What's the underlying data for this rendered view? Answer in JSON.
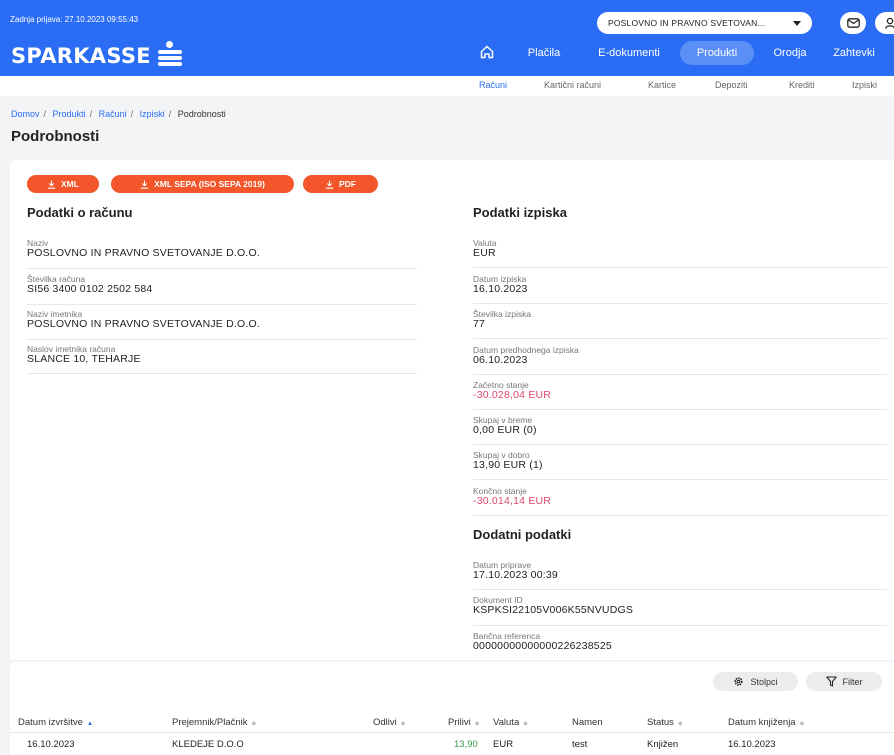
{
  "header": {
    "last_login": "Zadnja prijava: 27.10.2023 09:55:43",
    "company": "POSLOVNO IN PRAVNO SVETOVAN...",
    "brand": "SPARKASSE",
    "nav": [
      "Plačila",
      "E-dokumenti",
      "Produkti",
      "Orodja",
      "Zahtevki"
    ],
    "active_nav": "Produkti"
  },
  "subnav": {
    "items": [
      "Računi",
      "Kartični računi",
      "Kartice",
      "Depoziti",
      "Krediti",
      "Izpiski"
    ],
    "active": "Računi"
  },
  "breadcrumb": [
    "Domov",
    "Produkti",
    "Računi",
    "Izpiski",
    "Podrobnosti"
  ],
  "page_title": "Podrobnosti",
  "buttons": {
    "xml": "XML",
    "xml_sepa": "XML SEPA (ISO SEPA 2019)",
    "pdf": "PDF"
  },
  "account": {
    "title": "Podatki o računu",
    "fields": [
      {
        "label": "Naziv",
        "value": "POSLOVNO IN PRAVNO SVETOVANJE D.O.O."
      },
      {
        "label": "Številka računa",
        "value": "SI56 3400 0102 2502 584"
      },
      {
        "label": "Naziv imetnika",
        "value": "POSLOVNO IN PRAVNO SVETOVANJE D.O.O."
      },
      {
        "label": "Naslov imetnika računa",
        "value": "SLANCE 10, TEHARJE"
      }
    ]
  },
  "statement": {
    "title": "Podatki izpiska",
    "fields": [
      {
        "label": "Valuta",
        "value": "EUR"
      },
      {
        "label": "Datum izpiska",
        "value": "16.10.2023"
      },
      {
        "label": "Številka izpiska",
        "value": "77"
      },
      {
        "label": "Datum predhodnega izpiska",
        "value": "06.10.2023"
      },
      {
        "label": "Začetno stanje",
        "value": "-30.028,04 EUR"
      },
      {
        "label": "Skupaj v breme",
        "value": "0,00 EUR (0)"
      },
      {
        "label": "Skupaj v dobro",
        "value": "13,90 EUR (1)"
      },
      {
        "label": "Končno stanje",
        "value": "-30.014,14 EUR"
      }
    ]
  },
  "additional": {
    "title": "Dodatni podatki",
    "fields": [
      {
        "label": "Datum priprave",
        "value": "17.10.2023 00:39"
      },
      {
        "label": "Dokument ID",
        "value": "KSPKSI22105V006K55NVUDGS"
      },
      {
        "label": "Bančna referenca",
        "value": "00000000000000226238525"
      }
    ]
  },
  "table": {
    "tools": {
      "columns": "Stolpci",
      "filter": "Filter"
    },
    "headers": [
      "Datum izvršitve",
      "Prejemnik/Plačnik",
      "Odlivi",
      "Prilivi",
      "Valuta",
      "Namen",
      "Status",
      "Datum knjiženja"
    ],
    "rows": [
      [
        "16.10.2023",
        "KLEDEJE D.O.O",
        "",
        "13,90",
        "EUR",
        "test",
        "Knjižen",
        "16.10.2023"
      ]
    ]
  },
  "colors": {
    "primary": "#2a6df4",
    "accent": "#f2562a",
    "negative": "#e0496a",
    "positive": "#3a9a4a"
  }
}
